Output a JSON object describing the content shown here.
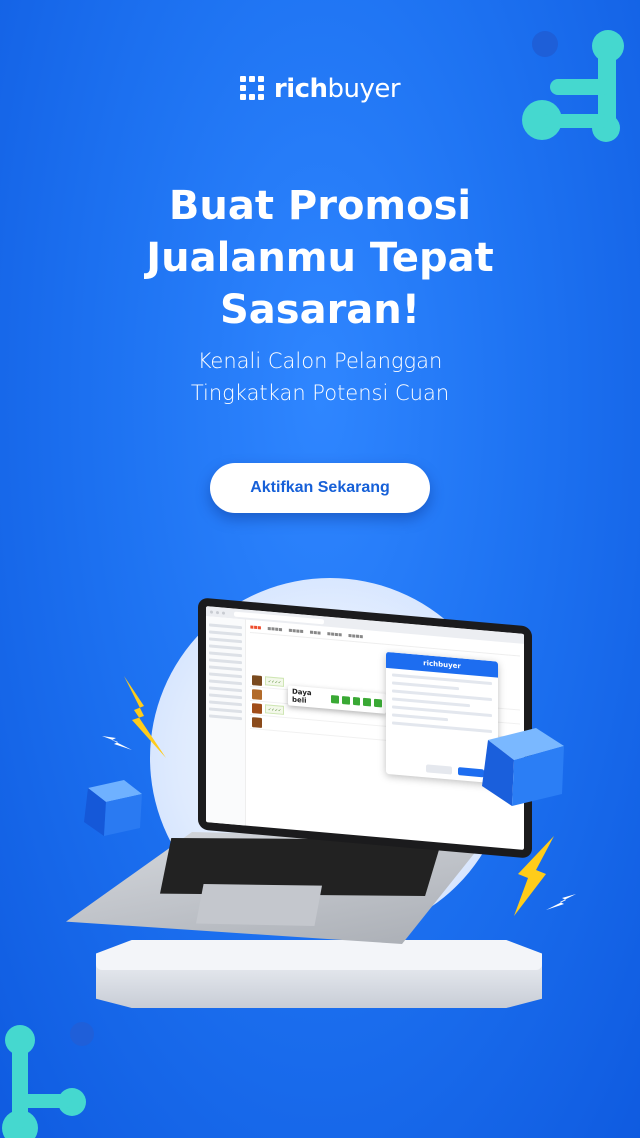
{
  "brand": {
    "logo_bold": "rich",
    "logo_light": "buyer"
  },
  "hero": {
    "headline_line1": "Buat Promosi",
    "headline_line2": "Jualanmu Tepat",
    "headline_line3": "Sasaran!",
    "sub_line1": "Kenali Calon Pelanggan",
    "sub_line2": "Tingkatkan Potensi Cuan",
    "cta_label": "Aktifkan Sekarang"
  },
  "mockup": {
    "popup_brand": "richbuyer",
    "daya_label": "Daya beli"
  },
  "colors": {
    "background": "#1e73f2",
    "cta_text": "#1660d8",
    "accent_teal": "#3fd6d0",
    "bolt": "#ffcc1a"
  },
  "icons": [
    "logo-mark-icon",
    "molecule-icon",
    "lightning-bolt-icon",
    "cube-icon",
    "laptop-icon"
  ]
}
